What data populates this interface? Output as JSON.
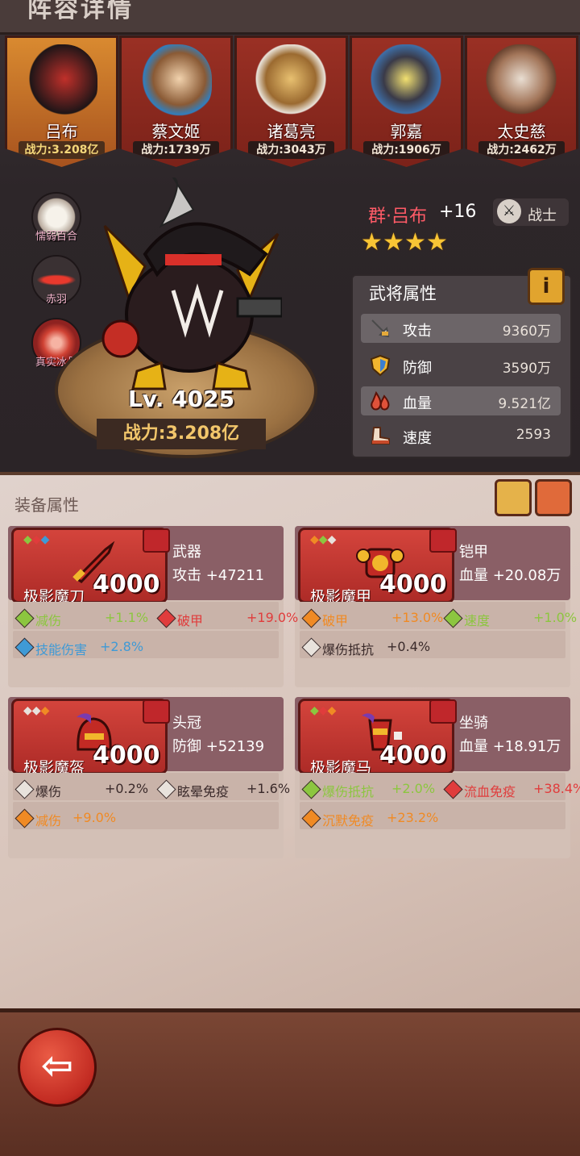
{
  "title": "阵容详情",
  "heroes": [
    {
      "name": "吕布",
      "power": "战力:3.208亿",
      "selected": true
    },
    {
      "name": "蔡文姬",
      "power": "战力:1739万"
    },
    {
      "name": "诸葛亮",
      "power": "战力:3043万"
    },
    {
      "name": "郭嘉",
      "power": "战力:1906万"
    },
    {
      "name": "太史慈",
      "power": "战力:2462万"
    }
  ],
  "skills": [
    {
      "label": "懦弱百合"
    },
    {
      "label": "赤羽"
    },
    {
      "label": "真实冰晶"
    }
  ],
  "hero": {
    "level": "Lv. 4025",
    "power": "战力:3.208亿",
    "name": "群·吕布",
    "plus": "+16",
    "class": "战士",
    "stars": 4
  },
  "stats": {
    "title": "武将属性",
    "info": "i",
    "rows": [
      {
        "name": "攻击",
        "value": "9360万",
        "icon": "sword-icon"
      },
      {
        "name": "防御",
        "value": "3590万",
        "icon": "shield-icon"
      },
      {
        "name": "血量",
        "value": "9.521亿",
        "icon": "blood-icon"
      },
      {
        "name": "速度",
        "value": "2593",
        "icon": "boot-icon"
      }
    ]
  },
  "equip_title": "装备属性",
  "equipment": [
    {
      "name": "极影魔刀",
      "level": "4000",
      "slot": "武器",
      "main": "攻击  +47211",
      "subs": [
        {
          "label": "减伤",
          "value": "+1.1%",
          "color": "#8cc63f"
        },
        {
          "label": "破甲",
          "value": "+19.0%",
          "color": "#e03c3c"
        },
        {
          "label": "技能伤害",
          "value": "+2.8%",
          "color": "#3f9ad6"
        }
      ]
    },
    {
      "name": "极影魔甲",
      "level": "4000",
      "slot": "铠甲",
      "main": "血量 +20.08万",
      "subs": [
        {
          "label": "破甲",
          "value": "+13.0%",
          "color": "#f08a24"
        },
        {
          "label": "速度",
          "value": "+1.0%",
          "color": "#8cc63f"
        },
        {
          "label": "爆伤抵抗",
          "value": "+0.4%",
          "color": "#e8e2dc"
        }
      ]
    },
    {
      "name": "极影魔盔",
      "level": "4000",
      "slot": "头冠",
      "main": "防御  +52139",
      "subs": [
        {
          "label": "爆伤",
          "value": "+0.2%",
          "color": "#e8e2dc"
        },
        {
          "label": "眩晕免疫",
          "value": "+1.6%",
          "color": "#e8e2dc"
        },
        {
          "label": "减伤",
          "value": "+9.0%",
          "color": "#f08a24"
        }
      ]
    },
    {
      "name": "极影魔马",
      "level": "4000",
      "slot": "坐骑",
      "main": "血量 +18.91万",
      "subs": [
        {
          "label": "爆伤抵抗",
          "value": "+2.0%",
          "color": "#8cc63f"
        },
        {
          "label": "流血免疫",
          "value": "+38.4%",
          "color": "#e03c3c"
        },
        {
          "label": "沉默免疫",
          "value": "+23.2%",
          "color": "#f08a24"
        }
      ]
    }
  ],
  "back": "back-arrow-icon"
}
